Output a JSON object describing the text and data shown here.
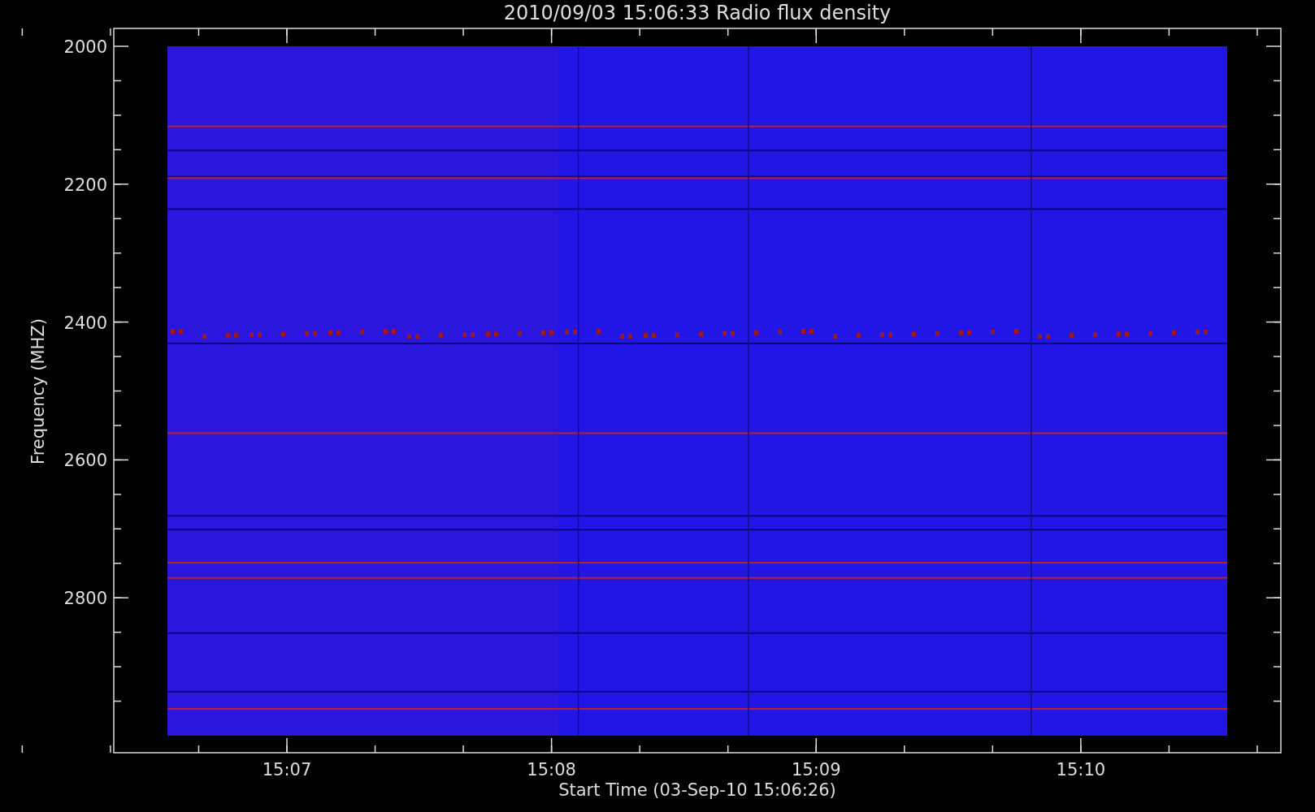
{
  "plot": {
    "title": "2010/09/03 15:06:33 Radio flux density",
    "ylabel": "Frequency (MHZ)",
    "xlabel": "Start Time (03-Sep-10 15:06:26)",
    "yticks": [
      "2000",
      "2200",
      "2400",
      "2600",
      "2800"
    ],
    "xticks": [
      "15:07",
      "15:08",
      "15:09",
      "15:10"
    ]
  }
}
